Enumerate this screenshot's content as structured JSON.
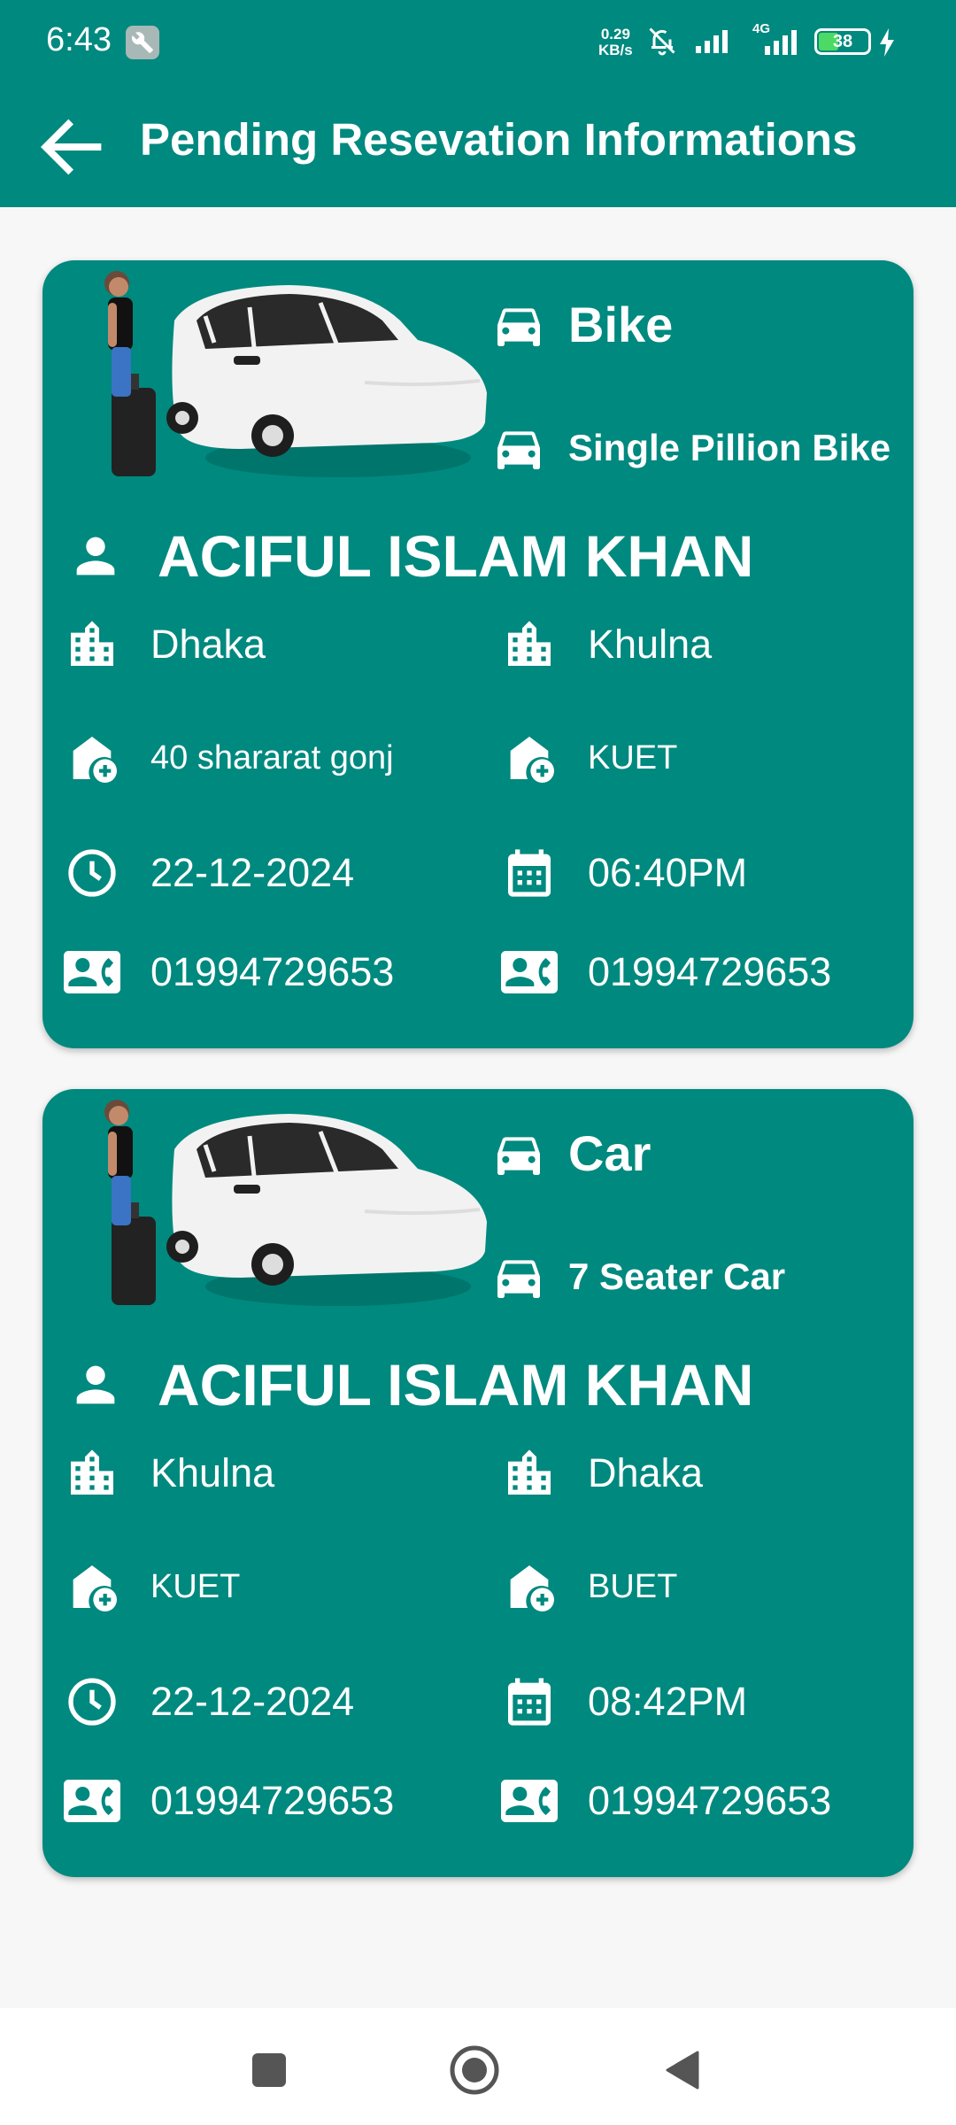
{
  "status_bar": {
    "time": "6:43",
    "net_speed_value": "0.29",
    "net_speed_unit": "KB/s",
    "network_type": "4G",
    "battery": "38"
  },
  "app_bar": {
    "title": "Pending Resevation Informations"
  },
  "reservations": [
    {
      "vehicle_type": "Bike",
      "vehicle_name": "Single Pillion Bike",
      "passenger_name": "ACIFUL ISLAM KHAN",
      "from_city": "Dhaka",
      "to_city": "Khulna",
      "pickup_location": "40 shararat gonj",
      "dropoff_location": "KUET",
      "date": "22-12-2024",
      "time": "06:40PM",
      "phone_1": "01994729653",
      "phone_2": "01994729653"
    },
    {
      "vehicle_type": "Car",
      "vehicle_name": "7 Seater Car",
      "passenger_name": "ACIFUL ISLAM KHAN",
      "from_city": "Khulna",
      "to_city": "Dhaka",
      "pickup_location": "KUET",
      "dropoff_location": "BUET",
      "date": "22-12-2024",
      "time": "08:42PM",
      "phone_1": "01994729653",
      "phone_2": "01994729653"
    }
  ],
  "colors": {
    "primary": "#00897f",
    "background": "#f7f7f7",
    "text_on_primary": "#ffffff"
  },
  "icons": {
    "back": "arrow-back-icon",
    "vehicle": "car-icon",
    "person": "person-icon",
    "city": "city-icon",
    "location": "add-home-icon",
    "date": "clock-icon",
    "time": "calendar-icon",
    "phone": "contact-phone-icon"
  }
}
